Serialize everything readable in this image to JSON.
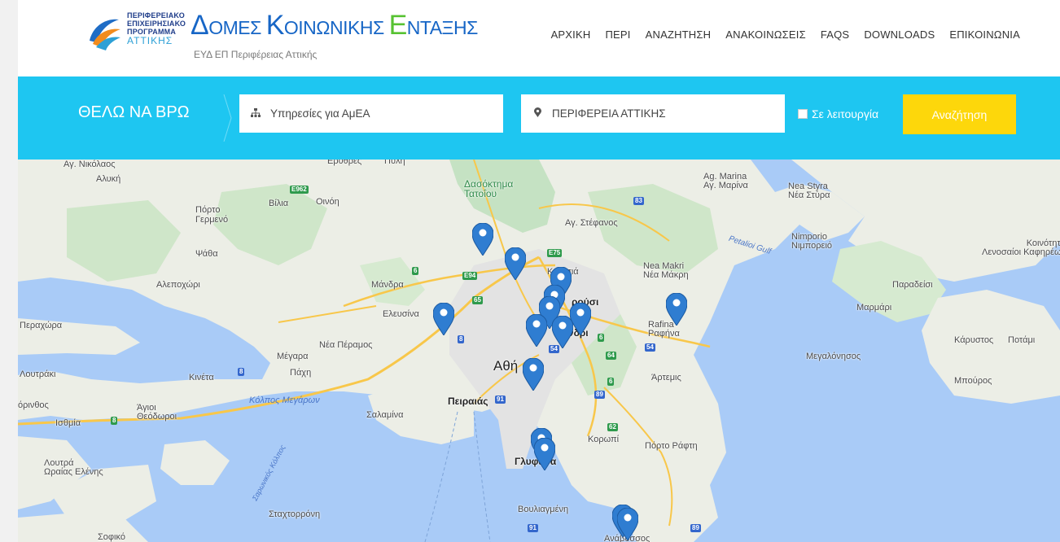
{
  "header": {
    "program_lines": [
      "ΠΕΡΙΦΕΡΕΙΑΚΟ",
      "ΕΠΙΧΕΙΡΗΣΙΑΚΟ",
      "ΠΡΟΓΡΑΜΜΑ",
      "ΑΤΤΙΚΗΣ"
    ],
    "brand": {
      "p1": "Δ",
      "p2": "ΟΜΕΣ ",
      "p3": "Κ",
      "p4": "ΟΙΝΩΝΙΚΗΣ ",
      "p5": "Ε",
      "p6": "ΝΤΑΞΗΣ"
    },
    "subtitle": "ΕΥΔ ΕΠ Περιφέρειας Αττικής",
    "nav": [
      "ΑΡΧΙΚΗ",
      "ΠΕΡΙ",
      "ΑΝΑΖΗΤΗΣΗ",
      "ΑΝΑΚΟΙΝΩΣΕΙΣ",
      "FAQS",
      "DOWNLOADS",
      "ΕΠΙΚΟΙΝΩΝΙΑ"
    ]
  },
  "search": {
    "heading": "ΘΕΛΩ ΝΑ ΒΡΩ",
    "service_value": "Υπηρεσίες για ΑμΕΑ",
    "region_value": "ΠΕΡΙΦΕΡΕΙΑ ΑΤΤΙΚΗΣ",
    "checkbox_label": "Σε λειτουργία",
    "checkbox_checked": false,
    "button_label": "Αναζήτηση",
    "service_icon": "sitemap-icon",
    "region_icon": "map-marker-icon"
  },
  "colors": {
    "accent": "#1ec6f1",
    "button": "#fdd70b",
    "brand_blue": "#1766c6",
    "brand_green": "#57c232",
    "pin": "#2f7dd1"
  },
  "map": {
    "labels": {
      "ag_nikolaos": "Αγ. Νικόλαος",
      "alyki": "Αλυκή",
      "erythres": "Ερυθρές",
      "pyli": "Πύλη",
      "vilia": "Βίλια",
      "oinoi": "Οινόη",
      "porto_germeno": "Πόρτο\nΓερμενό",
      "psatha": "Ψάθα",
      "alepochori": "Αλεποχώρι",
      "mandra": "Μάνδρα",
      "elefsina": "Ελευσίνα",
      "perachora": "Περαχώρα",
      "megara": "Μέγαρα",
      "nea_peramos": "Νέα Πέραμος",
      "loutraki": "Λουτράκι",
      "kineta": "Κινέτα",
      "pachi": "Πάχη",
      "korinthos": "όρινθος",
      "isthmia": "Ισθμία",
      "agioi_theodoroi": "Άγιοι\nΘεόδωροι",
      "kolpos_megaron": "Κόλπος Μεγάρων",
      "salamina": "Σαλαμίνα",
      "peiraias": "Πειραιάς",
      "athina": "Αθή",
      "loutra_oraias": "Λουτρά\nΩραίας Ελένης",
      "saronikos": "Σαρωνικός Κόλπος",
      "staxtorroni": "Σταχτορρόνη",
      "sofiko": "Σοφικό",
      "dasoktima": "Δασόκτημα\nΤατοΐου",
      "ag_stefanos": "Αγ. Στέφανος",
      "ag_marina": "Ag. Marina\nΑγ. Μαρίνα",
      "nea_styra": "Nea Styra\nΝέα Στύρα",
      "nimporio": "Nimporio\nΝιμπορειό",
      "petalioi": "Petalioi Gulf",
      "nea_makri": "Nea Makri\nΝέα Μάκρη",
      "rafina": "Rafina\nΡαφήνα",
      "artemis": "Άρτεμις",
      "koropi": "Κορωπί",
      "porto_rafti": "Πόρτο Ράφτη",
      "glyfada": "Γλυφάδα",
      "vouliagmeni": "Βουλιαγμένη",
      "kifisia": "Κηφισιά",
      "marousi": "ρούσι",
      "chalandri": "λάνδρι",
      "koinotita": "Κοινότητα\nΛενοσαίοι Καφηρέως",
      "paradeisi": "Παραδείσι",
      "marmari": "Μαρμάρι",
      "karystos": "Κάρυστος",
      "potami": "Ποτάμι",
      "megalonisos": "Μεγαλόνησος",
      "mpouros": "Μπούρος",
      "anavysos": "Ανάβυσσος"
    },
    "pin_count": 15,
    "pin_icon": "map-pin-icon"
  }
}
